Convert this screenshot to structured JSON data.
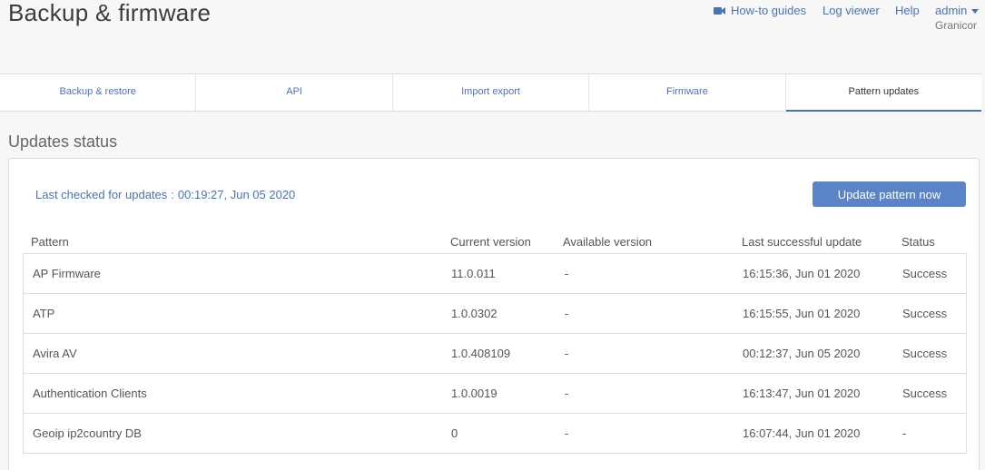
{
  "header": {
    "title": "Backup & firmware",
    "links": {
      "guides": "How-to guides",
      "guides_icon": "video-camera-icon",
      "log_viewer": "Log viewer",
      "help": "Help",
      "admin": "admin"
    },
    "org": "Granicor"
  },
  "tabs": [
    {
      "label": "Backup & restore"
    },
    {
      "label": "API"
    },
    {
      "label": "Import export"
    },
    {
      "label": "Firmware"
    },
    {
      "label": "Pattern updates",
      "active": true
    }
  ],
  "section": {
    "title": "Updates status",
    "last_checked_label": "Last checked for updates",
    "last_checked_sep": ":",
    "last_checked_value": "00:19:27, Jun 05 2020",
    "update_button": "Update pattern now"
  },
  "table": {
    "headers": [
      "Pattern",
      "Current version",
      "Available version",
      "Last successful update",
      "Status"
    ],
    "rows": [
      [
        "AP Firmware",
        "11.0.011",
        "-",
        "16:15:36, Jun 01 2020",
        "Success"
      ],
      [
        "ATP",
        "1.0.0302",
        "-",
        "16:15:55, Jun 01 2020",
        "Success"
      ],
      [
        "Avira AV",
        "1.0.408109",
        "-",
        "00:12:37, Jun 05 2020",
        "Success"
      ],
      [
        "Authentication Clients",
        "1.0.0019",
        "-",
        "16:13:47, Jun 01 2020",
        "Success"
      ],
      [
        "Geoip ip2country DB",
        "0",
        "-",
        "16:07:44, Jun 01 2020",
        "-"
      ]
    ]
  },
  "colors": {
    "accent": "#4a73b5",
    "button": "#5a84c7"
  }
}
